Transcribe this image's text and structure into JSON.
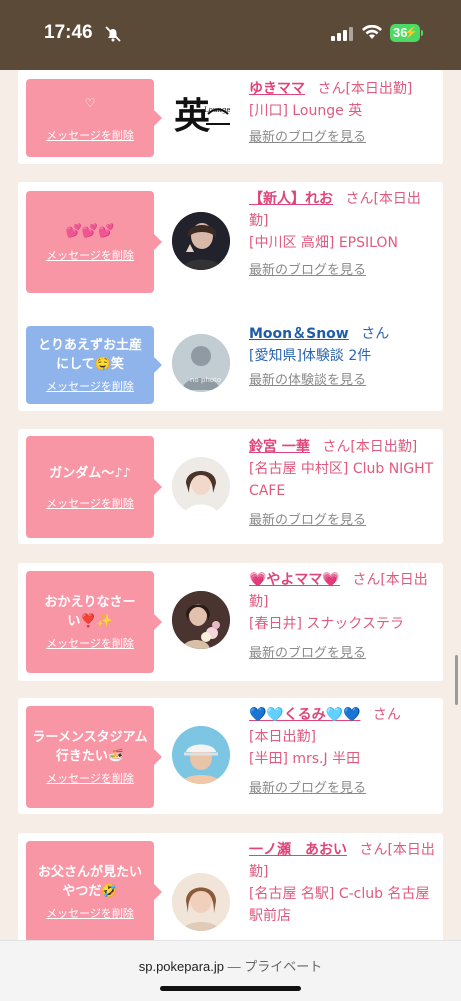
{
  "status": {
    "time": "17:46",
    "battery": "36"
  },
  "cards": [
    {
      "message": "♡",
      "delete_label": "メッセージを削除",
      "name": "ゆきママ",
      "san": "さん",
      "status": "[本日出勤]",
      "meta": "[川口] Lounge 英",
      "blog": "最新のブログを見る"
    },
    {
      "message": "💕💕💕",
      "delete_label": "メッセージを削除",
      "name": "【新人】れお",
      "san": "さん",
      "status": "[本日出勤]",
      "meta": "[中川区 高畑] EPSILON",
      "blog": "最新のブログを見る"
    },
    {
      "message": "とりあえずお土産にして🤤笑",
      "delete_label": "メッセージを削除",
      "name": "Moon＆Snow",
      "san": "さん",
      "status": "",
      "meta": "[愛知県]体験談 2件",
      "blog": "最新の体験談を見る"
    },
    {
      "message": "ガンダム〜♪♪",
      "delete_label": "メッセージを削除",
      "name": "鈴宮 一華",
      "san": "さん",
      "status": "[本日出勤]",
      "meta": "[名古屋 中村区] Club NIGHT CAFE",
      "blog": "最新のブログを見る"
    },
    {
      "message": "おかえりなさーい❣️✨",
      "delete_label": "メッセージを削除",
      "name": "💗やよママ💗",
      "san": "さん",
      "status": "[本日出勤]",
      "meta": "[春日井] スナックステラ",
      "blog": "最新のブログを見る"
    },
    {
      "message": "ラーメンスタジアム行きたい🍜",
      "delete_label": "メッセージを削除",
      "name": "💙🩵くるみ🩵💙",
      "san": "さん",
      "status": "[本日出勤]",
      "meta": "[半田] mrs.J 半田",
      "blog": "最新のブログを見る"
    },
    {
      "message": "お父さんが見たいやつだ🤣",
      "delete_label": "メッセージを削除",
      "name": "一ノ瀬　あおい",
      "san": "さん",
      "status": "[本日出勤]",
      "meta": "[名古屋 名駅] C-club 名古屋駅前店",
      "blog": ""
    }
  ],
  "urlbar": {
    "domain": "sp.pokepara.jp",
    "separator": " — ",
    "mode": "プライベート"
  },
  "colors": {
    "header": "#5b4a38",
    "bubble_pink": "#f996a6",
    "bubble_blue": "#8fb4ec",
    "name_pink": "#e0457a",
    "name_blue": "#1f5ca8"
  }
}
